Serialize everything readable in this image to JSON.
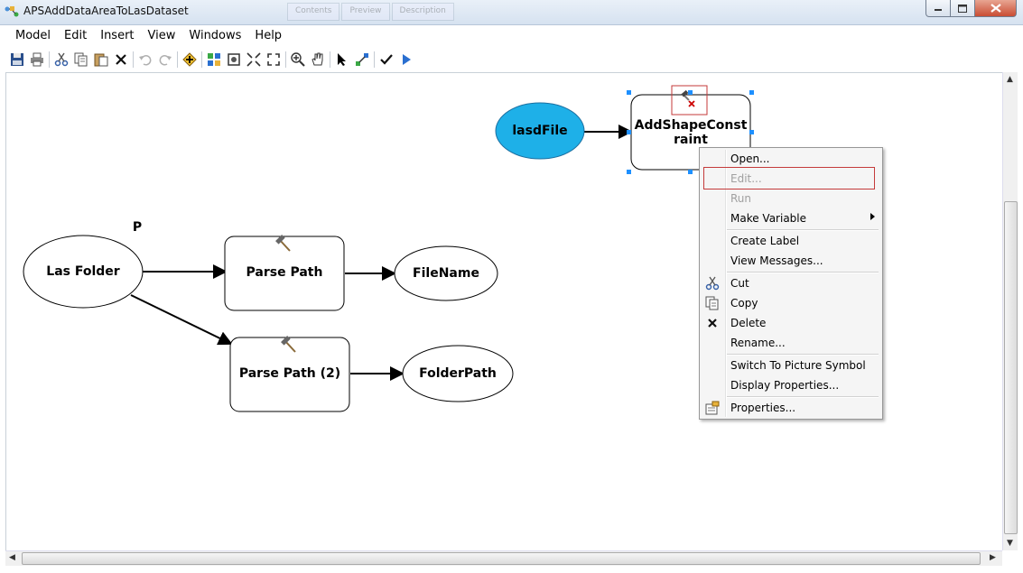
{
  "window": {
    "title": "APSAddDataAreaToLasDataset"
  },
  "ghost_tabs": [
    "Contents",
    "Preview",
    "Description"
  ],
  "menubar": [
    "Model",
    "Edit",
    "Insert",
    "View",
    "Windows",
    "Help"
  ],
  "toolbar": [
    {
      "name": "save-icon"
    },
    {
      "name": "print-icon"
    },
    {
      "sep": true
    },
    {
      "name": "cut-icon"
    },
    {
      "name": "copy-icon"
    },
    {
      "name": "paste-icon"
    },
    {
      "name": "delete-icon"
    },
    {
      "sep": true
    },
    {
      "name": "undo-icon"
    },
    {
      "name": "redo-icon"
    },
    {
      "sep": true
    },
    {
      "name": "add-data-icon"
    },
    {
      "sep": true
    },
    {
      "name": "auto-layout-icon"
    },
    {
      "name": "full-extent-icon"
    },
    {
      "name": "fixed-zoom-in-icon"
    },
    {
      "name": "fixed-zoom-out-icon"
    },
    {
      "sep": true
    },
    {
      "name": "zoom-in-icon"
    },
    {
      "name": "pan-icon"
    },
    {
      "sep": true
    },
    {
      "name": "select-icon"
    },
    {
      "name": "connect-icon"
    },
    {
      "sep": true
    },
    {
      "name": "validate-icon"
    },
    {
      "name": "run-icon"
    }
  ],
  "diagram": {
    "nodes": {
      "lasdfile": "lasdFile",
      "addshape_line1": "AddShapeConst",
      "addshape_line2": "raint",
      "las_folder": "Las Folder",
      "parse_path": "Parse Path",
      "filename": "FileName",
      "parse_path_2": "Parse Path (2)",
      "folderpath": "FolderPath"
    },
    "param_marker": "P"
  },
  "context_menu": {
    "items": [
      {
        "label": "Open...",
        "enabled": true
      },
      {
        "label": "Edit...",
        "enabled": false
      },
      {
        "label": "Run",
        "enabled": false
      },
      {
        "label": "Make Variable",
        "enabled": true,
        "submenu": true
      },
      {
        "label": "Create Label",
        "enabled": true
      },
      {
        "label": "View Messages...",
        "enabled": true
      },
      {
        "label": "Cut",
        "enabled": true,
        "icon": "scissors-icon"
      },
      {
        "label": "Copy",
        "enabled": true,
        "icon": "copy-icon"
      },
      {
        "label": "Delete",
        "enabled": true,
        "icon": "delete-x-icon"
      },
      {
        "label": "Rename...",
        "enabled": true
      },
      {
        "label": "Switch To Picture Symbol",
        "enabled": true
      },
      {
        "label": "Display Properties...",
        "enabled": true
      },
      {
        "label": "Properties...",
        "enabled": true,
        "icon": "properties-icon"
      }
    ]
  },
  "colors": {
    "input_variable": "#1eb0e8",
    "tool_fill": "#ffffff",
    "highlight_red": "#c43a3a",
    "selection_handle": "#1e90ff"
  }
}
